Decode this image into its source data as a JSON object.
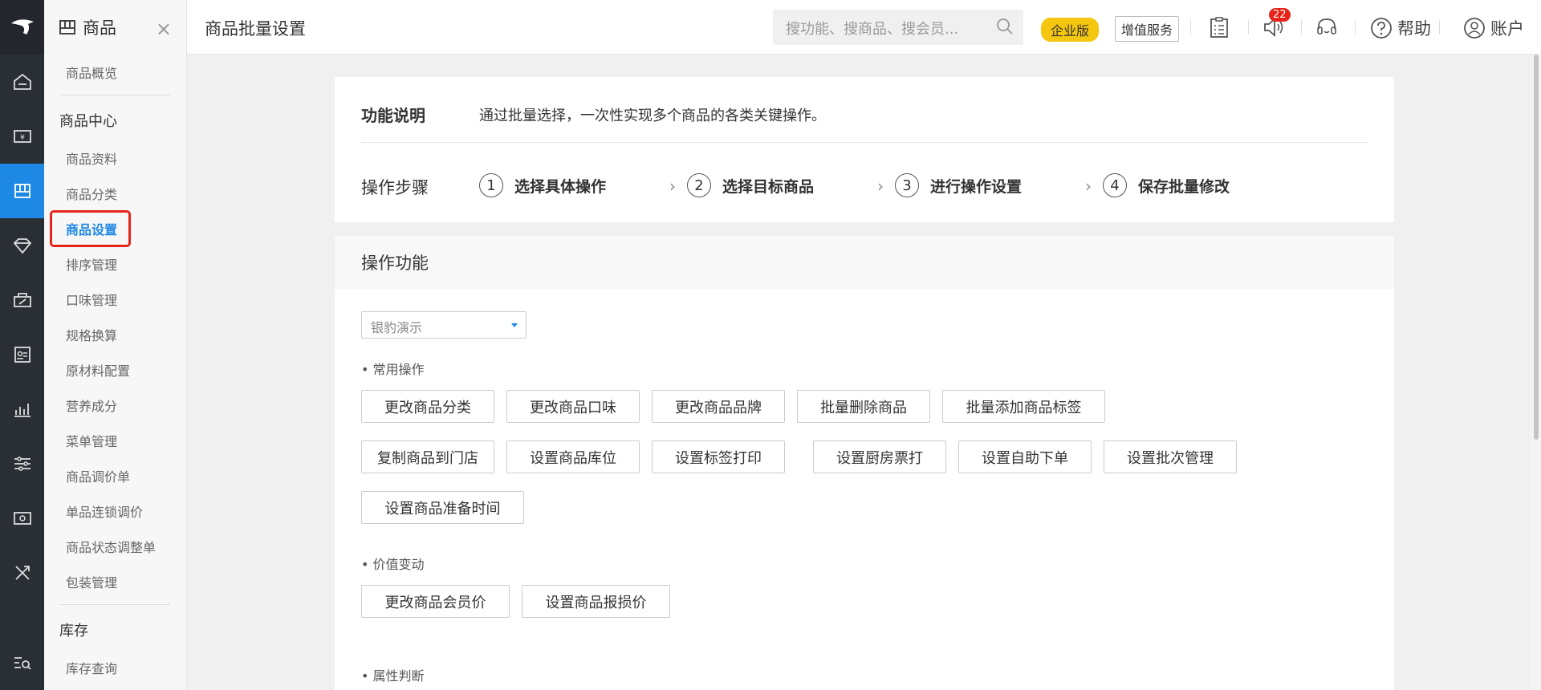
{
  "rail": {
    "icons": [
      "logo-icon",
      "home-icon",
      "finance-icon",
      "goods-icon",
      "member-icon",
      "promotion-icon",
      "staff-icon",
      "report-icon",
      "settings-icon",
      "cashier-icon",
      "tools-icon",
      "search-menu-icon"
    ]
  },
  "sidebar": {
    "header": "商品",
    "close": "×",
    "overview": "商品概览",
    "section_center": "商品中心",
    "items": [
      "商品资料",
      "商品分类",
      "商品设置",
      "排序管理",
      "口味管理",
      "规格换算",
      "原材料配置",
      "营养成分",
      "菜单管理",
      "商品调价单",
      "单品连锁调价",
      "商品状态调整单",
      "包装管理"
    ],
    "section_stock": "库存",
    "stock_items": [
      "库存查询"
    ]
  },
  "topbar": {
    "title": "商品批量设置",
    "search_placeholder": "搜功能、搜商品、搜会员...",
    "edition": "企业版",
    "value_added": "增值服务",
    "notif_count": "22",
    "help": "帮助",
    "account": "账户"
  },
  "intro": {
    "label": "功能说明",
    "desc": "通过批量选择，一次性实现多个商品的各类关键操作。",
    "steps_label": "操作步骤",
    "steps": [
      {
        "num": "1",
        "label": "选择具体操作"
      },
      {
        "num": "2",
        "label": "选择目标商品"
      },
      {
        "num": "3",
        "label": "进行操作设置"
      },
      {
        "num": "4",
        "label": "保存批量修改"
      }
    ],
    "chevron": "›"
  },
  "ops": {
    "title": "操作功能",
    "store_select": "银豹演示",
    "group_common": "• 常用操作",
    "common_buttons": [
      "更改商品分类",
      "更改商品口味",
      "更改商品品牌",
      "批量删除商品",
      "批量添加商品标签",
      "复制商品到门店",
      "设置商品库位",
      "设置标签打印",
      "设置厨房票打",
      "设置自助下单",
      "设置批次管理",
      "设置商品准备时间"
    ],
    "group_value": "• 价值变动",
    "value_buttons": [
      "更改商品会员价",
      "设置商品报损价"
    ],
    "group_attr": "• 属性判断"
  },
  "colors": {
    "accent": "#1e88e5",
    "rail_bg": "#2a2f36",
    "highlight_border": "#e6241a",
    "edition_badge": "#f5c60f"
  }
}
